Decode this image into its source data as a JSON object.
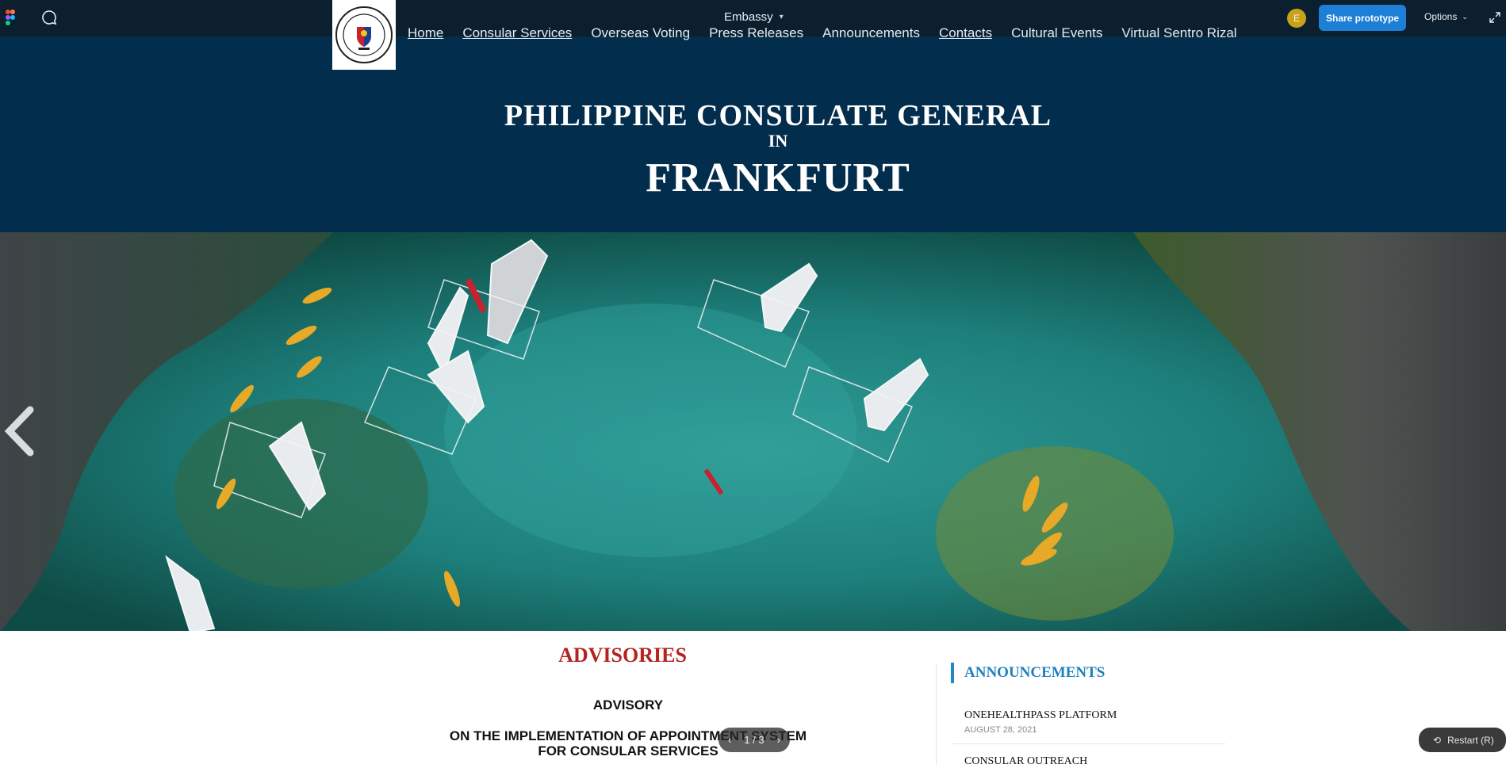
{
  "figma": {
    "file_name": "Embassy",
    "avatar_initial": "E",
    "share_label": "Share prototype",
    "options_label": "Options",
    "restart_label": "Restart (R)",
    "accent": "#1d7fd6"
  },
  "nav": {
    "items": [
      {
        "label": "Home",
        "underlined": true
      },
      {
        "label": "Consular Services",
        "underlined": true
      },
      {
        "label": "Overseas Voting",
        "underlined": false
      },
      {
        "label": "Press Releases",
        "underlined": false
      },
      {
        "label": "Announcements",
        "underlined": false
      },
      {
        "label": "Contacts",
        "underlined": true
      },
      {
        "label": "Cultural Events",
        "underlined": false
      },
      {
        "label": "Virtual Sentro Rizal",
        "underlined": false
      }
    ]
  },
  "header": {
    "line1": "PHILIPPINE CONSULATE GENERAL",
    "line2": "IN",
    "line3": "FRANKFURT",
    "bg_color": "#032d4d"
  },
  "advisories": {
    "title": "ADVISORIES",
    "label": "ADVISORY",
    "body_line1": "ON THE IMPLEMENTATION OF APPOINTMENT SYSTEM",
    "body_line2": "FOR CONSULAR SERVICES",
    "pager": "1 / 3",
    "title_color": "#b3231f"
  },
  "announcements": {
    "title": "ANNOUNCEMENTS",
    "items": [
      {
        "title": "ONEHEALTHPASS PLATFORM",
        "date": "AUGUST 28, 2021"
      },
      {
        "title": "CONSULAR OUTREACH",
        "date": ""
      }
    ],
    "accent": "#1d80bf"
  }
}
